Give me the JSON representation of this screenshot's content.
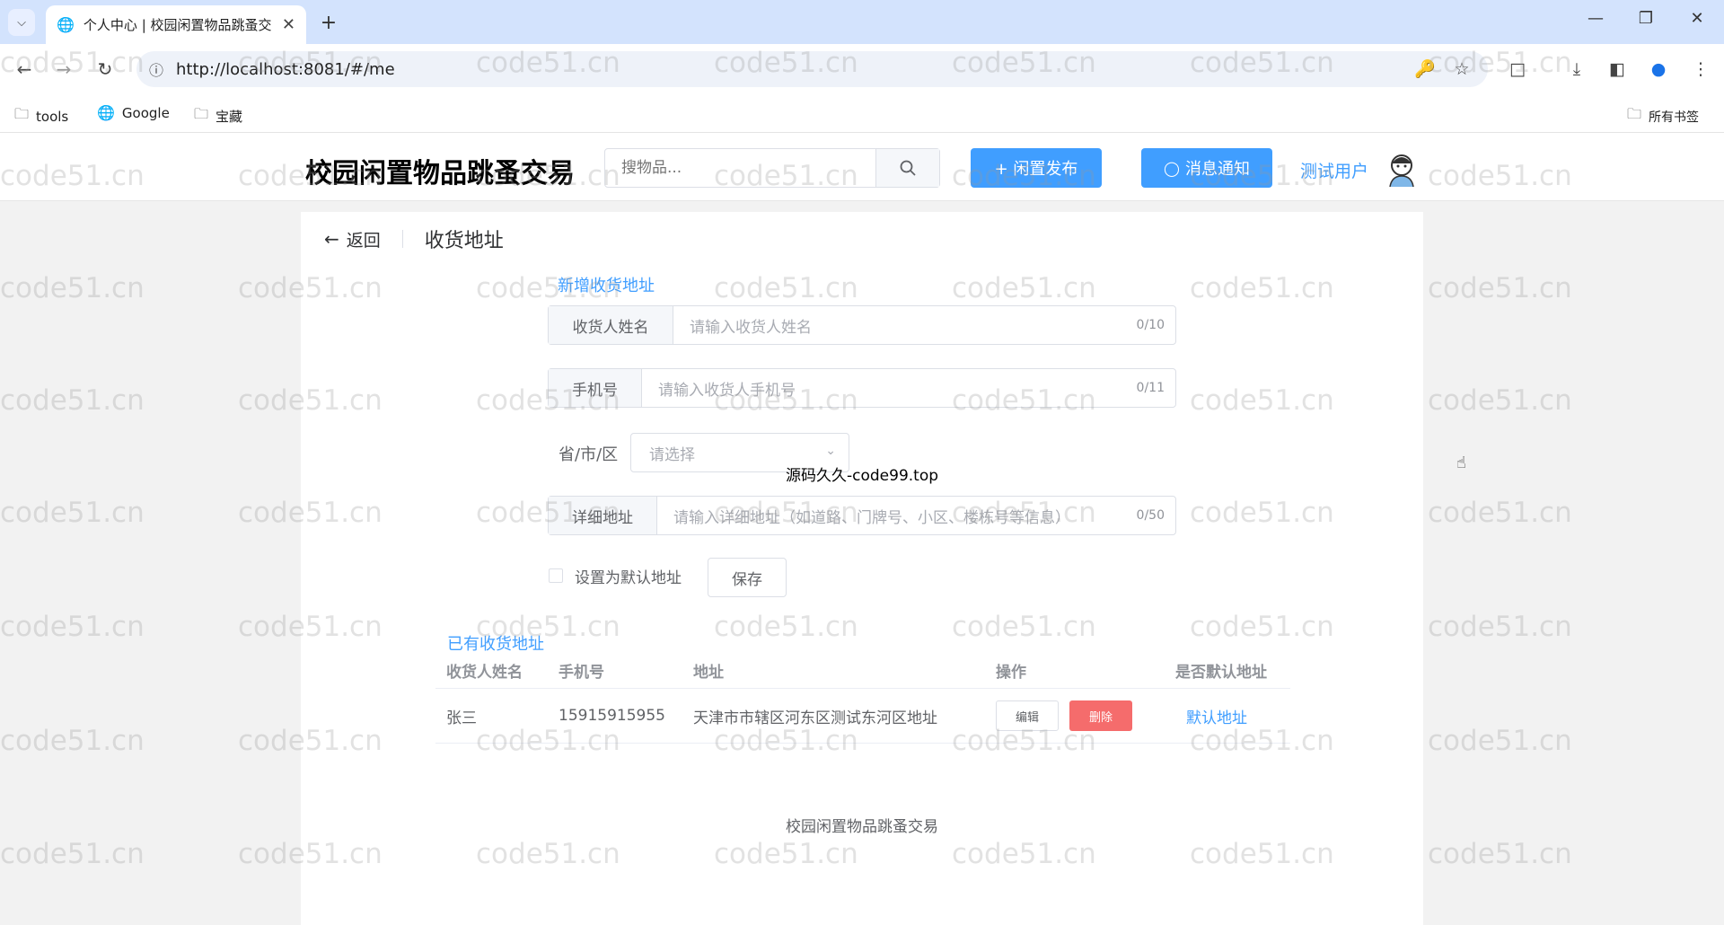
{
  "browser": {
    "tab_title": "个人中心 | 校园闲置物品跳蚤交",
    "url": "http://localhost:8081/#/me",
    "bookmarks": [
      "tools",
      "Google",
      "宝藏"
    ],
    "all_bookmarks": "所有书签"
  },
  "header": {
    "site_title": "校园闲置物品跳蚤交易",
    "search_placeholder": "搜物品...",
    "publish_button": "+ 闲置发布",
    "notify_button": "消息通知",
    "username": "测试用户"
  },
  "page": {
    "back_label": "返回",
    "title": "收货地址"
  },
  "form": {
    "section_title": "新增收货地址",
    "name_label": "收货人姓名",
    "name_placeholder": "请输入收货人姓名",
    "name_count": "0/10",
    "phone_label": "手机号",
    "phone_placeholder": "请输入收货人手机号",
    "phone_count": "0/11",
    "region_label": "省/市/区",
    "region_placeholder": "请选择",
    "detail_label": "详细地址",
    "detail_placeholder": "请输入详细地址（如道路、门牌号、小区、楼栋号等信息）",
    "detail_count": "0/50",
    "default_checkbox": "设置为默认地址",
    "save_button": "保存"
  },
  "address_list": {
    "section_title": "已有收货地址",
    "columns": [
      "收货人姓名",
      "手机号",
      "地址",
      "操作",
      "是否默认地址"
    ],
    "rows": [
      {
        "name": "张三",
        "phone": "15915915955",
        "address": "天津市市辖区河东区测试东河区地址",
        "edit": "编辑",
        "delete": "删除",
        "default": "默认地址"
      }
    ]
  },
  "footer": "校园闲置物品跳蚤交易",
  "overlay_note": "源码久久-code99.top",
  "watermark": "code51.cn",
  "colors": {
    "primary": "#409eff",
    "danger": "#f56c6c",
    "chrome_tabbar": "#d3e3fd"
  }
}
